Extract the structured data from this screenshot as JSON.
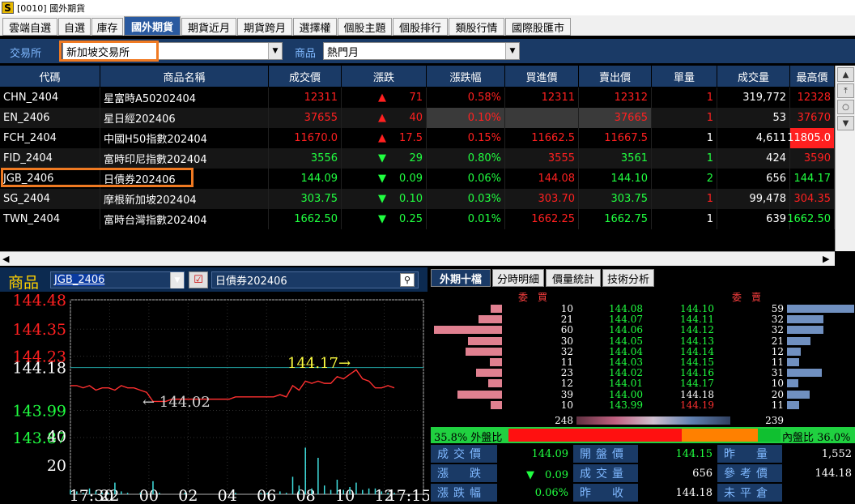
{
  "window": {
    "title": "[0010] 國外期貨",
    "logo": "S"
  },
  "tabs": [
    "雲端自選",
    "自選",
    "庫存",
    "國外期貨",
    "期貨近月",
    "期貨跨月",
    "選擇權",
    "個股主題",
    "個股排行",
    "類股行情",
    "國際股匯市"
  ],
  "active_tab": 3,
  "filter": {
    "exchange_label": "交易所",
    "exchange_value": "新加坡交易所",
    "product_label": "商品",
    "product_value": "熱門月"
  },
  "grid": {
    "headers": [
      "代碼",
      "商品名稱",
      "成交價",
      "漲跌",
      "漲跌幅",
      "買進價",
      "賣出價",
      "單量",
      "成交量",
      "最高價"
    ],
    "rows": [
      {
        "code": "CHN_2404",
        "name": "星富時A50202404",
        "price": "12311",
        "dir": "▲",
        "chg": "71",
        "pct": "0.58%",
        "bid": "12311",
        "ask": "12312",
        "qty": "1",
        "vol": "319,772",
        "high": "12328",
        "color": "red"
      },
      {
        "code": "EN_2406",
        "name": "星日經202406",
        "price": "37655",
        "dir": "▲",
        "chg": "40",
        "pct": "0.10%",
        "bid": "",
        "ask": "37665",
        "qty": "1",
        "vol": "53",
        "high": "37670",
        "color": "red"
      },
      {
        "code": "FCH_2404",
        "name": "中國H50指數202404",
        "price": "11670.0",
        "dir": "▲",
        "chg": "17.5",
        "pct": "0.15%",
        "bid": "11662.5",
        "ask": "11667.5",
        "qty": "1",
        "vol": "4,611",
        "high": "11805.0",
        "color": "red"
      },
      {
        "code": "FID_2404",
        "name": "富時印尼指數202404",
        "price": "3556",
        "dir": "▼",
        "chg": "29",
        "pct": "0.80%",
        "bid": "3555",
        "ask": "3561",
        "qty": "1",
        "vol": "424",
        "high": "3590",
        "color": "green"
      },
      {
        "code": "JGB_2406",
        "name": "日債券202406",
        "price": "144.09",
        "dir": "▼",
        "chg": "0.09",
        "pct": "0.06%",
        "bid": "144.08",
        "ask": "144.10",
        "qty": "2",
        "vol": "656",
        "high": "144.17",
        "color": "green"
      },
      {
        "code": "SG_2404",
        "name": "摩根新加坡202404",
        "price": "303.75",
        "dir": "▼",
        "chg": "0.10",
        "pct": "0.03%",
        "bid": "303.70",
        "ask": "303.75",
        "qty": "1",
        "vol": "99,478",
        "high": "304.35",
        "color": "green"
      },
      {
        "code": "TWN_2404",
        "name": "富時台灣指數202404",
        "price": "1662.50",
        "dir": "▼",
        "chg": "0.25",
        "pct": "0.01%",
        "bid": "1662.25",
        "ask": "1662.75",
        "qty": "1",
        "vol": "639",
        "high": "1662.50",
        "color": "green"
      }
    ]
  },
  "product": {
    "label": "商品",
    "code": "JGB_2406",
    "name": "日債券202406"
  },
  "chart_data": {
    "type": "line",
    "y_ticks": [
      "144.48",
      "144.35",
      "144.23",
      "144.18",
      "143.99",
      "143.87"
    ],
    "vol_ticks": [
      "40",
      "20"
    ],
    "x_ticks": [
      "17:30",
      "22",
      "00",
      "02",
      "04",
      "06",
      "08",
      "10",
      "12",
      "17:15"
    ],
    "annotations": {
      "high": "144.17→",
      "low": "← 144.02"
    },
    "ylim": [
      143.87,
      144.48
    ],
    "reference": 144.18,
    "series": [
      {
        "values": [
          144.1,
          144.1,
          144.09,
          144.1,
          144.08,
          144.09,
          144.09,
          144.08,
          144.1,
          144.09,
          144.09,
          144.08,
          144.07,
          144.03,
          144.03,
          144.03,
          144.04,
          144.04,
          144.04,
          144.04,
          144.04,
          144.04,
          144.04,
          144.04,
          144.04,
          144.04,
          144.05,
          144.05,
          144.05,
          144.05,
          144.05,
          144.05,
          144.05,
          144.06,
          144.05,
          144.1,
          144.08,
          144.12,
          144.11,
          144.12,
          144.11,
          144.11,
          144.14,
          144.13,
          144.15,
          144.17,
          144.13,
          144.12,
          144.09,
          144.09,
          144.1,
          144.09
        ]
      }
    ],
    "volume": [
      3,
      2,
      1,
      4,
      2,
      1,
      1,
      8,
      2,
      1,
      0,
      1,
      0,
      9,
      1,
      0,
      0,
      0,
      1,
      0,
      0,
      0,
      0,
      0,
      0,
      0,
      1,
      0,
      0,
      0,
      1,
      1,
      0,
      2,
      1,
      12,
      6,
      32,
      4,
      25,
      6,
      3,
      10,
      3,
      5,
      8,
      3,
      4,
      4,
      2,
      1,
      1
    ]
  },
  "orderbook": {
    "tabs": [
      "外期十檔",
      "分時明細",
      "價量統計",
      "技術分析"
    ],
    "bid_header": "委　買",
    "ask_header": "委　賣",
    "rows": [
      {
        "bq": "10",
        "bp": "144.08",
        "ap": "144.10",
        "aq": "59"
      },
      {
        "bq": "21",
        "bp": "144.07",
        "ap": "144.11",
        "aq": "32"
      },
      {
        "bq": "60",
        "bp": "144.06",
        "ap": "144.12",
        "aq": "32"
      },
      {
        "bq": "30",
        "bp": "144.05",
        "ap": "144.13",
        "aq": "21"
      },
      {
        "bq": "32",
        "bp": "144.04",
        "ap": "144.14",
        "aq": "12"
      },
      {
        "bq": "11",
        "bp": "144.03",
        "ap": "144.15",
        "aq": "11"
      },
      {
        "bq": "23",
        "bp": "144.02",
        "ap": "144.16",
        "aq": "31"
      },
      {
        "bq": "12",
        "bp": "144.01",
        "ap": "144.17",
        "aq": "10"
      },
      {
        "bq": "39",
        "bp": "144.00",
        "ap": "144.18",
        "aq": "20"
      },
      {
        "bq": "10",
        "bp": "143.99",
        "ap": "144.19",
        "aq": "11"
      }
    ],
    "bid_total": "248",
    "ask_total": "239",
    "out_ratio": "35.8% 外盤比",
    "in_ratio": "內盤比 36.0%"
  },
  "quote": [
    {
      "l1": "成交價",
      "v1": "144.09",
      "l2": "開盤價",
      "v2": "144.15",
      "l3": "昨　量",
      "v3": "1,552"
    },
    {
      "l1": "漲　跌",
      "v1": "▼　0.09",
      "l2": "成交量",
      "v2": "656",
      "l3": "參考價",
      "v3": "144.18"
    },
    {
      "l1": "漲跌幅",
      "v1": "0.06%",
      "l2": "昨　收",
      "v2": "144.18",
      "l3": "未平倉",
      "v3": ""
    }
  ]
}
